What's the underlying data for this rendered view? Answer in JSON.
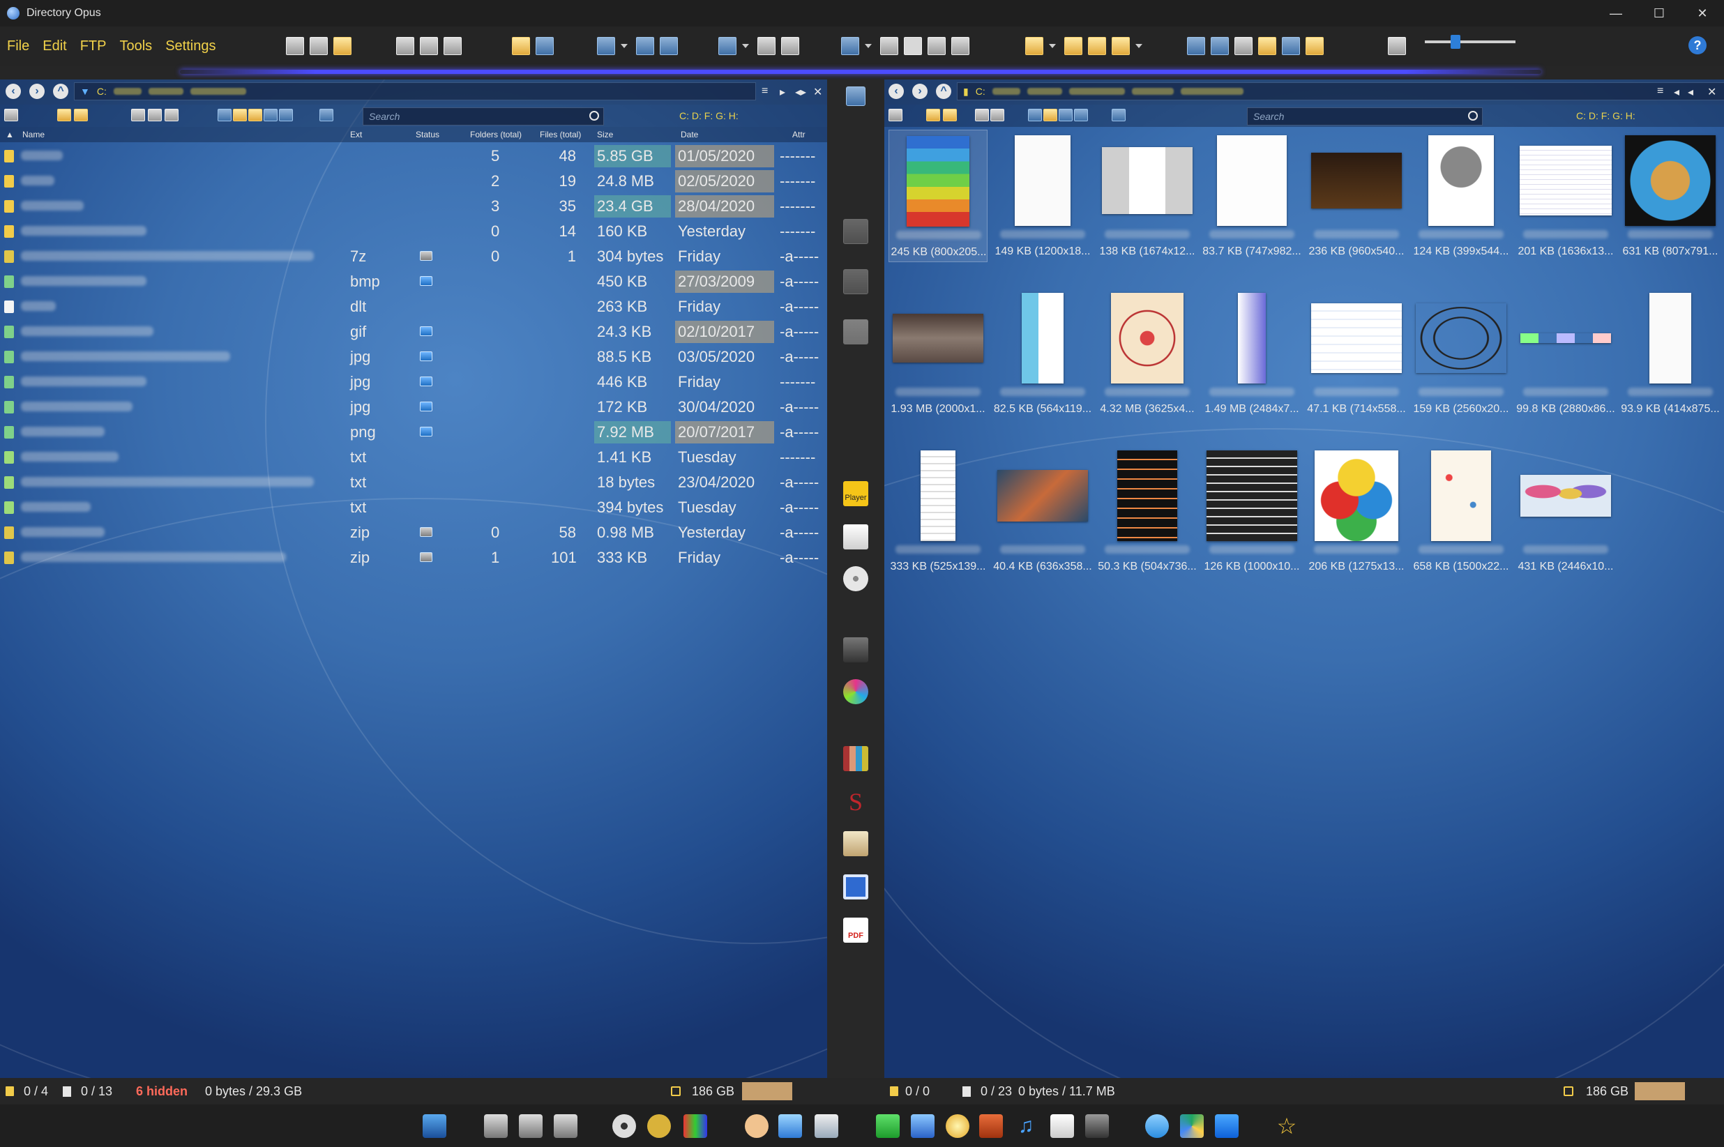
{
  "window": {
    "title": "Directory Opus",
    "controls": [
      "—",
      "☐",
      "✕"
    ]
  },
  "menu": [
    "File",
    "Edit",
    "FTP",
    "Tools",
    "Settings"
  ],
  "help_label": "?",
  "left": {
    "path_prefix": "C:",
    "search_placeholder": "Search",
    "drives": "C: D: F: G: H:",
    "columns": {
      "name": "Name",
      "ext": "Ext",
      "status": "Status",
      "folders": "Folders (total)",
      "files": "Files (total)",
      "size": "Size",
      "date": "Date",
      "attr": "Attr"
    },
    "rows": [
      {
        "ext": "",
        "status": "",
        "folders": "5",
        "files": "48",
        "size": "5.85 GB",
        "date": "01/05/2020",
        "attr": "-------",
        "hs": true,
        "hd": true,
        "icon": "folder"
      },
      {
        "ext": "",
        "status": "",
        "folders": "2",
        "files": "19",
        "size": "24.8 MB",
        "date": "02/05/2020",
        "attr": "-------",
        "hs": false,
        "hd": true,
        "icon": "folder"
      },
      {
        "ext": "",
        "status": "",
        "folders": "3",
        "files": "35",
        "size": "23.4 GB",
        "date": "28/04/2020",
        "attr": "-------",
        "hs": true,
        "hd": true,
        "icon": "folder"
      },
      {
        "ext": "",
        "status": "",
        "folders": "0",
        "files": "14",
        "size": "160 KB",
        "date": "Yesterday",
        "attr": "-------",
        "hs": false,
        "hd": false,
        "icon": "folder"
      },
      {
        "ext": "7z",
        "status": "archive",
        "folders": "0",
        "files": "1",
        "size": "304 bytes",
        "date": "Friday",
        "attr": "-a-----",
        "hs": false,
        "hd": false,
        "icon": "archive"
      },
      {
        "ext": "bmp",
        "status": "image",
        "folders": "",
        "files": "",
        "size": "450 KB",
        "date": "27/03/2009",
        "attr": "-a-----",
        "hs": false,
        "hd": true,
        "icon": "image"
      },
      {
        "ext": "dlt",
        "status": "",
        "folders": "",
        "files": "",
        "size": "263 KB",
        "date": "Friday",
        "attr": "-a-----",
        "hs": false,
        "hd": false,
        "icon": "doc"
      },
      {
        "ext": "gif",
        "status": "image",
        "folders": "",
        "files": "",
        "size": "24.3 KB",
        "date": "02/10/2017",
        "attr": "-a-----",
        "hs": false,
        "hd": true,
        "icon": "image"
      },
      {
        "ext": "jpg",
        "status": "image",
        "folders": "",
        "files": "",
        "size": "88.5 KB",
        "date": "03/05/2020",
        "attr": "-a-----",
        "hs": false,
        "hd": false,
        "icon": "image"
      },
      {
        "ext": "jpg",
        "status": "image",
        "folders": "",
        "files": "",
        "size": "446 KB",
        "date": "Friday",
        "attr": "-------",
        "hs": false,
        "hd": false,
        "icon": "image"
      },
      {
        "ext": "jpg",
        "status": "image",
        "folders": "",
        "files": "",
        "size": "172 KB",
        "date": "30/04/2020",
        "attr": "-a-----",
        "hs": false,
        "hd": false,
        "icon": "image"
      },
      {
        "ext": "png",
        "status": "image",
        "folders": "",
        "files": "",
        "size": "7.92 MB",
        "date": "20/07/2017",
        "attr": "-a-----",
        "hs": true,
        "hd": true,
        "icon": "image"
      },
      {
        "ext": "txt",
        "status": "",
        "folders": "",
        "files": "",
        "size": "1.41 KB",
        "date": "Tuesday",
        "attr": "-------",
        "hs": false,
        "hd": false,
        "icon": "text"
      },
      {
        "ext": "txt",
        "status": "",
        "folders": "",
        "files": "",
        "size": "18 bytes",
        "date": "23/04/2020",
        "attr": "-a-----",
        "hs": false,
        "hd": false,
        "icon": "text"
      },
      {
        "ext": "txt",
        "status": "",
        "folders": "",
        "files": "",
        "size": "394 bytes",
        "date": "Tuesday",
        "attr": "-a-----",
        "hs": false,
        "hd": false,
        "icon": "text"
      },
      {
        "ext": "zip",
        "status": "archive",
        "folders": "0",
        "files": "58",
        "size": "0.98 MB",
        "date": "Yesterday",
        "attr": "-a-----",
        "hs": false,
        "hd": false,
        "icon": "archive"
      },
      {
        "ext": "zip",
        "status": "archive",
        "folders": "1",
        "files": "101",
        "size": "333 KB",
        "date": "Friday",
        "attr": "-a-----",
        "hs": false,
        "hd": false,
        "icon": "archive"
      }
    ],
    "status": {
      "folders": "0 / 4",
      "files": "0 / 13",
      "hidden": "6 hidden",
      "bytes": "0 bytes / 29.3 GB",
      "free": "186 GB"
    }
  },
  "right": {
    "path_prefix": "C:",
    "search_placeholder": "Search",
    "drives": "C: D: F: G: H:",
    "thumbs": [
      {
        "caption": "245 KB (800x205...",
        "kind": "steps"
      },
      {
        "caption": "149 KB (1200x18...",
        "kind": "flow"
      },
      {
        "caption": "138 KB (1674x12...",
        "kind": "boxes"
      },
      {
        "caption": "83.7 KB (747x982...",
        "kind": "doc"
      },
      {
        "caption": "236 KB (960x540...",
        "kind": "dark"
      },
      {
        "caption": "124 KB (399x544...",
        "kind": "gear"
      },
      {
        "caption": "201 KB (1636x13...",
        "kind": "table"
      },
      {
        "caption": "631 KB (807x791...",
        "kind": "globe"
      },
      {
        "caption": "1.93 MB (2000x1...",
        "kind": "photo"
      },
      {
        "caption": "82.5 KB (564x119...",
        "kind": "column"
      },
      {
        "caption": "4.32 MB (3625x4...",
        "kind": "mandala"
      },
      {
        "caption": "1.49 MB (2484x7...",
        "kind": "strip"
      },
      {
        "caption": "47.1 KB (714x558...",
        "kind": "list"
      },
      {
        "caption": "159 KB (2560x20...",
        "kind": "ellipse"
      },
      {
        "caption": "99.8 KB (2880x86...",
        "kind": "chips"
      },
      {
        "caption": "93.9 KB (414x875...",
        "kind": "tall"
      },
      {
        "caption": "333 KB (525x139...",
        "kind": "narrow"
      },
      {
        "caption": "40.4 KB (636x358...",
        "kind": "circuit"
      },
      {
        "caption": "50.3 KB (504x736...",
        "kind": "spectrum"
      },
      {
        "caption": "126 KB (1000x10...",
        "kind": "chart"
      },
      {
        "caption": "206 KB (1275x13...",
        "kind": "venn"
      },
      {
        "caption": "658 KB (1500x22...",
        "kind": "tree"
      },
      {
        "caption": "431 KB (2446x10...",
        "kind": "map"
      }
    ],
    "status": {
      "folders": "0 / 0",
      "files": "0 / 23",
      "bytes": "0 bytes / 11.7 MB",
      "free": "186 GB"
    }
  },
  "midbar": {
    "player_label": "Player",
    "pdf_label": "PDF"
  }
}
